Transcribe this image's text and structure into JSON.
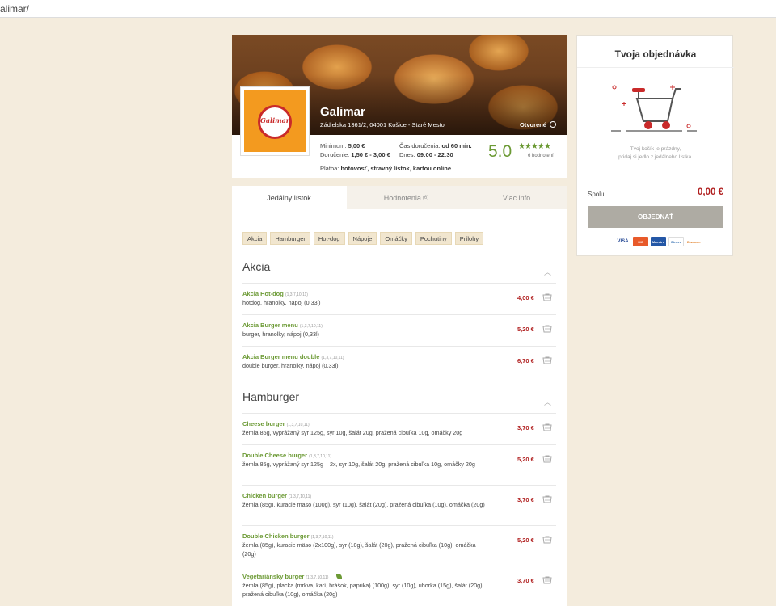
{
  "browser": {
    "url_fragment": "alimar/"
  },
  "restaurant": {
    "name": "Galimar",
    "logo_text": "Galimar",
    "address": "Zádielska 1361/2, 04001 Košice - Staré Mesto",
    "status": "Otvorené",
    "minimum_label": "Minimum:",
    "minimum_value": "5,00 €",
    "delivery_label": "Doručenie:",
    "delivery_value": "1,50 € - 3,00 €",
    "delivery_time_label": "Čas doručenia:",
    "delivery_time_value": "od 60 min.",
    "today_label": "Dnes:",
    "today_value": "09:00 - 22:30",
    "payment_label": "Platba:",
    "payment_value": "hotovosť, stravný lístok, kartou online",
    "rating": "5.0",
    "rating_stars": 5,
    "rating_count": "6 hodnotení"
  },
  "tabs": [
    {
      "label": "Jedálny lístok",
      "count": ""
    },
    {
      "label": "Hodnotenia",
      "count": "(6)"
    },
    {
      "label": "Viac info",
      "count": ""
    }
  ],
  "categories": [
    "Akcia",
    "Hamburger",
    "Hot-dog",
    "Nápoje",
    "Omáčky",
    "Pochutiny",
    "Prílohy"
  ],
  "sections": [
    {
      "title": "Akcia",
      "items": [
        {
          "name": "Akcia Hot-dog",
          "allergens": "(1,3,7,10,11)",
          "desc": "hotdog, hranolky, napoj (0,33l)",
          "price": "4,00 €"
        },
        {
          "name": "Akcia Burger menu",
          "allergens": "(1,3,7,10,11)",
          "desc": "burger, hranolky, nápoj (0,33l)",
          "price": "5,20 €"
        },
        {
          "name": "Akcia Burger menu double",
          "allergens": "(1,3,7,10,11)",
          "desc": "double burger, hranolky, nápoj (0,33l)",
          "price": "6,70 €"
        }
      ]
    },
    {
      "title": "Hamburger",
      "items": [
        {
          "name": "Cheese burger",
          "allergens": "(1,3,7,10,11)",
          "desc": "žemľa 85g, vyprážaný syr 125g, syr 10g, šalát 20g, pražená cibuľka 10g, omáčky 20g",
          "price": "3,70 €"
        },
        {
          "name": "Double Cheese burger",
          "allergens": "(1,3,7,10,11)",
          "desc": "žemľa 85g, vyprážaný syr 125g – 2x, syr 10g, šalát 20g, pražená cibuľka 10g, omáčky 20g",
          "price": "5,20 €"
        },
        {
          "name": "Chicken burger",
          "allergens": "(1,3,7,10,11)",
          "desc": "žemľa (85g), kuracie mäso (100g), syr (10g), šalát (20g), pražená cibuľka (10g), omáčka (20g)",
          "price": "3,70 €"
        },
        {
          "name": "Double Chicken burger",
          "allergens": "(1,3,7,10,11)",
          "desc": "žemľa (85g), kuracie mäso (2x100g), syr (10g), šalát (20g), pražená cibuľka (10g), omáčka (20g)",
          "price": "5,20 €"
        },
        {
          "name": "Vegetariánsky burger",
          "allergens": "(1,3,7,10,11)",
          "desc": "žemľa (85g), placka (mrkva, karí, hrášok, paprika) (100g), syr (10g), uhorka (15g), šalát (20g), pražená cibuľka (10g), omáčka (20g)",
          "price": "3,70 €",
          "vegetarian": true
        }
      ]
    }
  ],
  "order": {
    "title": "Tvoja objednávka",
    "empty_line1": "Tvoj košík je prázdny,",
    "empty_line2": "pridaj si jedlo z jedálneho lístka.",
    "total_label": "Spolu:",
    "total_value": "0,00 €",
    "button_label": "OBJEDNAŤ",
    "payment_cards": [
      "VISA",
      "MC",
      "Maestro",
      "Diners",
      "Discover"
    ]
  },
  "colors": {
    "accent_green": "#6c9a35",
    "price_red": "#b01e1e",
    "page_bg": "#f4ecdd",
    "button_gray": "#aeaba3",
    "logo_orange": "#f39a1f"
  }
}
